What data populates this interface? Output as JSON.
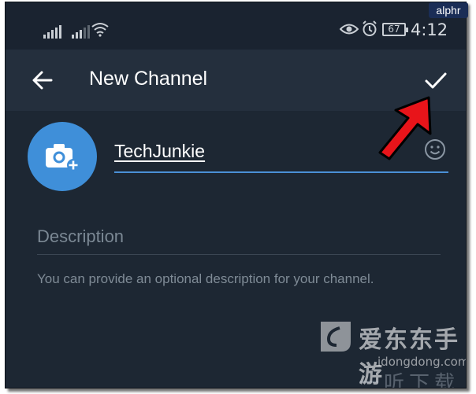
{
  "badge": {
    "text": "alphr"
  },
  "status_bar": {
    "battery": "67",
    "time": "4:12"
  },
  "app_bar": {
    "title": "New Channel"
  },
  "form": {
    "channel_name": "TechJunkie",
    "description_placeholder": "Description",
    "helper_text": "You can provide an optional description for your channel."
  },
  "watermark": {
    "brand_cn": "爱东东手游",
    "url": "idongdong.com",
    "footer_cn": "一听下载"
  },
  "colors": {
    "background": "#1d2733",
    "app_bar": "#242f3d",
    "accent": "#3f8fd9",
    "arrow": "#e8141a"
  },
  "icons": [
    "back-arrow-icon",
    "checkmark-icon",
    "camera-add-icon",
    "emoji-icon",
    "eye-icon",
    "alarm-icon",
    "wifi-icon",
    "signal-icon"
  ]
}
